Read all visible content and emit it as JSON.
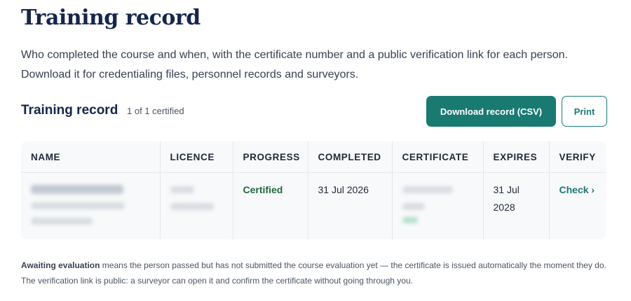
{
  "page": {
    "title": "Training record",
    "intro": "Who completed the course and when, with the certificate number and a public verification link for each person. Download it for credentialing files, personnel records and surveyors."
  },
  "section": {
    "title": "Training record",
    "count": "1 of 1 certified",
    "download_label": "Download record (CSV)",
    "print_label": "Print"
  },
  "table": {
    "columns": [
      "NAME",
      "LICENCE",
      "PROGRESS",
      "COMPLETED",
      "CERTIFICATE",
      "EXPIRES",
      "VERIFY"
    ],
    "rows": [
      {
        "progress": "Certified",
        "completed": "31 Jul 2026",
        "expires": "31 Jul 2028",
        "verify": "Check ›"
      }
    ]
  },
  "footnote": {
    "term": "Awaiting evaluation",
    "text": " means the person passed but has not submitted the course evaluation yet — the certificate is issued automatically the moment they do. The verification link is public: a surveyor can open it and confirm the certificate without going through you."
  },
  "colors": {
    "brand": "#197a72",
    "title": "#16264a",
    "certified": "#1f6b3a"
  }
}
